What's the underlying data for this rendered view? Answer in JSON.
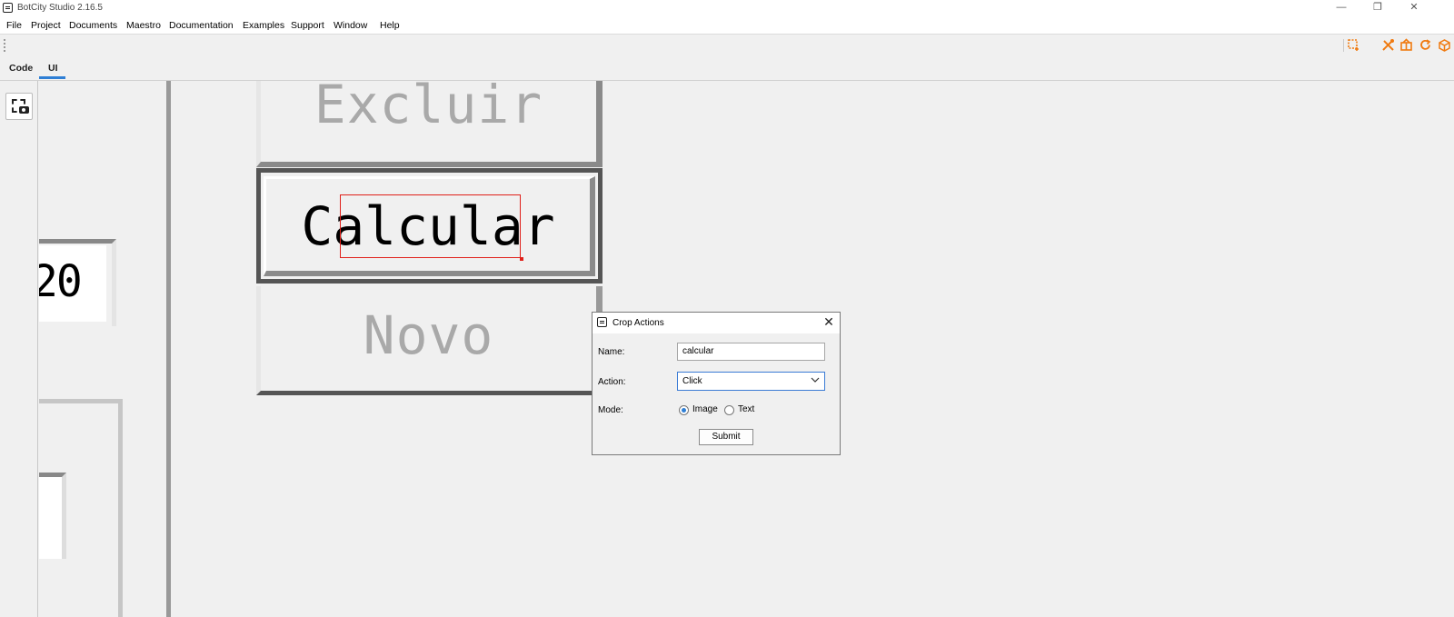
{
  "window": {
    "title": "BotCity Studio 2.16.5",
    "minimize": "—",
    "restore": "❐",
    "close": "✕"
  },
  "menu": [
    "File",
    "Project",
    "Documents",
    "Maestro",
    "Documentation",
    "Examples",
    "Support",
    "Window",
    "Help"
  ],
  "toolbar": {
    "icons": [
      "crop-icon",
      "tools-icon",
      "package-icon",
      "refresh-icon",
      "box-icon"
    ]
  },
  "tabs": [
    {
      "label": "Code",
      "active": false
    },
    {
      "label": "UI",
      "active": true
    }
  ],
  "canvas": {
    "partial_number": "20",
    "buttons": [
      "Excluir",
      "Calcular",
      "Novo"
    ]
  },
  "dialog": {
    "title": "Crop Actions",
    "name_label": "Name:",
    "name_value": "calcular",
    "action_label": "Action:",
    "action_value": "Click",
    "mode_label": "Mode:",
    "mode_options": [
      "Image",
      "Text"
    ],
    "mode_selected": "Image",
    "submit_label": "Submit"
  },
  "colors": {
    "accent": "#f07a10",
    "tab_underline": "#2f7fd5",
    "crop_box": "#e0201a"
  }
}
